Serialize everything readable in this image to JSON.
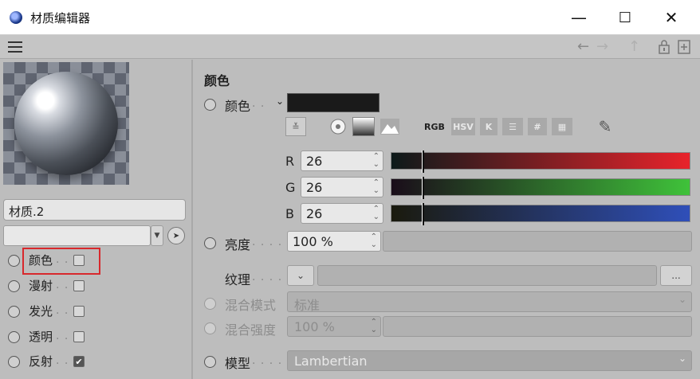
{
  "window": {
    "title": "材质编辑器",
    "minimize": "—",
    "maximize": "☐",
    "close": "✕"
  },
  "toolbar": {
    "back": "←",
    "forward": "→",
    "up": "↑"
  },
  "material": {
    "name": "材质.2",
    "preset_value": ""
  },
  "channels": [
    {
      "label": "颜色",
      "checked": false
    },
    {
      "label": "漫射",
      "checked": false
    },
    {
      "label": "发光",
      "checked": false
    },
    {
      "label": "透明",
      "checked": false
    },
    {
      "label": "反射",
      "checked": true
    }
  ],
  "color_section": {
    "title": "颜色",
    "color_label": "颜色",
    "swatch_color": "#1a1a1a",
    "mode_icons": [
      "RGB",
      "HSV",
      "K",
      "#"
    ],
    "r": {
      "label": "R",
      "value": "26",
      "fraction": 0.102
    },
    "g": {
      "label": "G",
      "value": "26",
      "fraction": 0.102
    },
    "b": {
      "label": "B",
      "value": "26",
      "fraction": 0.102
    },
    "brightness_label": "亮度",
    "brightness_value": "100 %",
    "texture_label": "纹理",
    "texture_button": "...",
    "blend_mode_label": "混合模式",
    "blend_mode_value": "标准",
    "blend_strength_label": "混合强度",
    "blend_strength_value": "100 %",
    "model_label": "模型",
    "model_value": "Lambertian"
  },
  "colors": {
    "red": "#e8232b",
    "green": "#3fc23a",
    "blue": "#2f4fb9",
    "highlight": "#d8282c"
  }
}
